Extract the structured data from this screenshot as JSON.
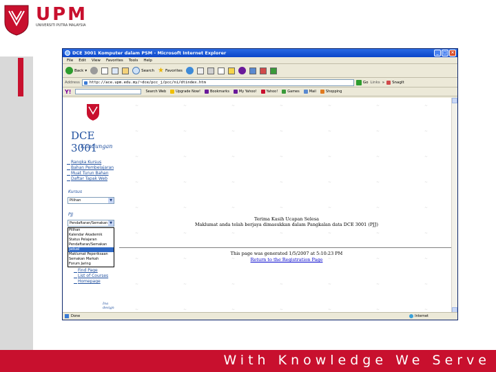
{
  "brand": {
    "logo": "UPM",
    "logo_sub": "UNIVERSITI PUTRA MALAYSIA",
    "slogan": "With Knowledge We Serve",
    "colors": {
      "primary": "#c8102e",
      "grey": "#d9d9d9"
    }
  },
  "window": {
    "title": "DCE 3001 Komputer dalam PSM - Microsoft Internet Explorer",
    "controls": [
      "minimize-icon",
      "maximize-icon",
      "close-icon"
    ],
    "menu": [
      "File",
      "Edit",
      "View",
      "Favorites",
      "Tools",
      "Help"
    ],
    "toolbar": {
      "back": "Back",
      "search": "Search",
      "favorites": "Favorites"
    },
    "address": {
      "label": "Address",
      "value": "http://ace.upm.edu.my/~dce/pcc_j/pcc/ni/dtindex.htm",
      "go": "Go",
      "links": "Links",
      "snagit": "SnagIt"
    },
    "linkbar": {
      "search_web": "Search Web",
      "upgrade": "Upgrade Now!",
      "bookmarks": "Bookmarks",
      "my_yahoo": "My Yahoo!",
      "yahoo": "Yahoo!",
      "games": "Games",
      "mail": "Mail",
      "shopping": "Shopping"
    }
  },
  "sidebar": {
    "title": "DCE 3001",
    "subtitle": "Kandungan",
    "links": [
      "Rangka Kursus",
      "Bahan Pembelajaran",
      "Muat Turun Bahan",
      "Daftar Tapak Web"
    ],
    "kursus_label": "Kursus",
    "kursus_select": "Pilihan",
    "pjj_label": "PJJ",
    "pjj_select": "Pendaftaran/Semakan",
    "dropdown_options": [
      "Pilihan",
      "Kalendar Akademik",
      "Status Pelajaran",
      "Pendaftaran/Semakan",
      "Jadual",
      "Maklumat Peperiksaan",
      "Semakan Markah",
      "Forum Jaring"
    ],
    "highlighted_option": "Jadual",
    "bottom_links": [
      "Find Page",
      "List of Courses",
      "Homepage"
    ],
    "signature": "Ina design"
  },
  "main": {
    "line1": "Terima Kasih Ucapan Selesa",
    "line2": "Maklumat anda telah berjaya dimasukkan dalam Pangkalan data DCE 3001 (PJJ)",
    "generated": "This page was generated 1/5/2007 at 5:10:23 PM",
    "return": "Return to the Registration Page"
  },
  "status": {
    "left": "Done",
    "zone": "Internet"
  }
}
